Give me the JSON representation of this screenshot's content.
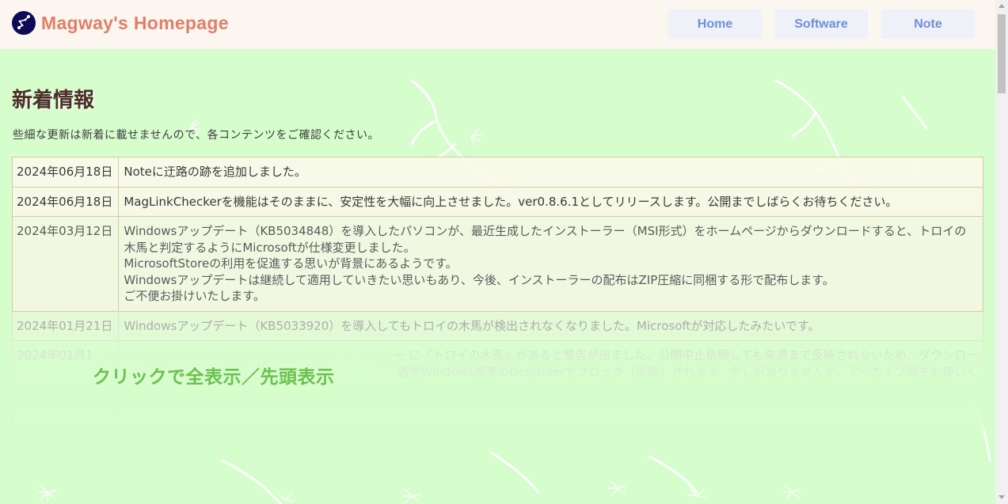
{
  "header": {
    "site_title": "Magway's Homepage",
    "logo_icon": "constellation-logo-icon",
    "nav": [
      {
        "label": "Home"
      },
      {
        "label": "Software"
      },
      {
        "label": "Note"
      }
    ]
  },
  "main": {
    "title": "新着情報",
    "notice": "些細な更新は新着に載せませんので、各コンテンツをご確認ください。",
    "news": [
      {
        "date": "2024年06月18日",
        "text": "Noteに迂路の跡を追加しました。"
      },
      {
        "date": "2024年06月18日",
        "text": "MagLinkCheckerを機能はそのままに、安定性を大幅に向上させました。ver0.8.6.1としてリリースします。公開までしばらくお待ちください。"
      },
      {
        "date": "2024年03月12日",
        "lines": [
          "Windowsアップデート（KB5034848）を導入したパソコンが、最近生成したインストーラー（MSI形式）をホームページからダウンロードすると、トロイの木馬と判定するようにMicrosoftが仕様変更しました。",
          "MicrosoftStoreの利用を促進する思いが背景にあるようです。",
          "Windowsアップデートは継続して適用していきたい思いもあり、今後、インストーラーの配布はZIP圧縮に同梱する形で配布します。",
          "ご不便お掛けいたします。"
        ]
      },
      {
        "date": "2024年01月21日",
        "text": "Windowsアップデート（KB5033920）を導入してもトロイの木馬が検出されなくなりました。Microsoftが対応したみたいです。"
      },
      {
        "date": "2024年01月1",
        "text": "ー に「トロイの木馬」があると警告が出ました。公開中止依頼しても来週まで反映されないため、ダウンロー",
        "text2": "通常Windows標準のDefenderでブロック（削除）されます。申し訳ありませんが、アーカイブ版をお使いく"
      }
    ],
    "expand_link": "クリックで全表示／先頭表示"
  },
  "colors": {
    "background": "#d6fdcc",
    "header_bg": "#fbf6ef",
    "title_accent": "#e07f6a",
    "nav_text": "#6f8fd4",
    "expand_link": "#6bc150"
  }
}
